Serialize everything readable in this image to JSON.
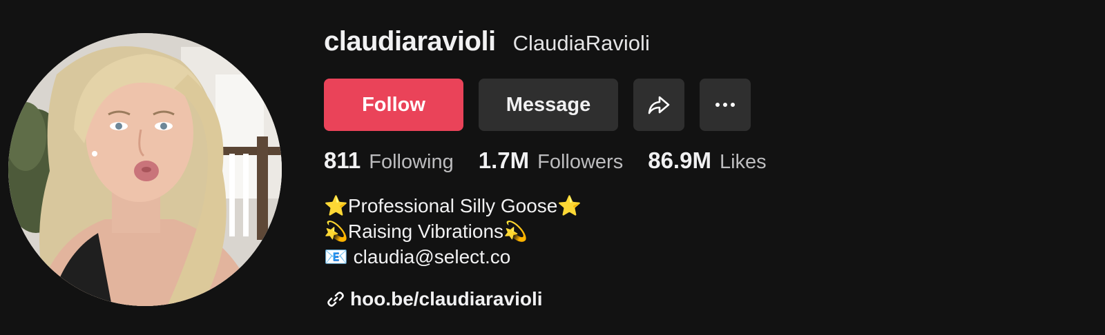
{
  "profile": {
    "username": "claudiaravioli",
    "nickname": "ClaudiaRavioli"
  },
  "actions": {
    "follow_label": "Follow",
    "message_label": "Message",
    "share_icon": "share-icon",
    "more_icon": "more-icon"
  },
  "stats": {
    "following_count": "811",
    "following_label": "Following",
    "followers_count": "1.7M",
    "followers_label": "Followers",
    "likes_count": "86.9M",
    "likes_label": "Likes"
  },
  "bio": {
    "line1": "⭐Professional Silly Goose⭐",
    "line2": "💫Raising Vibrations💫",
    "line3": "📧 claudia@select.co"
  },
  "link": {
    "icon": "link-icon",
    "text": "hoo.be/claudiaravioli"
  },
  "colors": {
    "background": "#121212",
    "follow_button": "#ea4359",
    "secondary_button": "#2f2f2f"
  }
}
